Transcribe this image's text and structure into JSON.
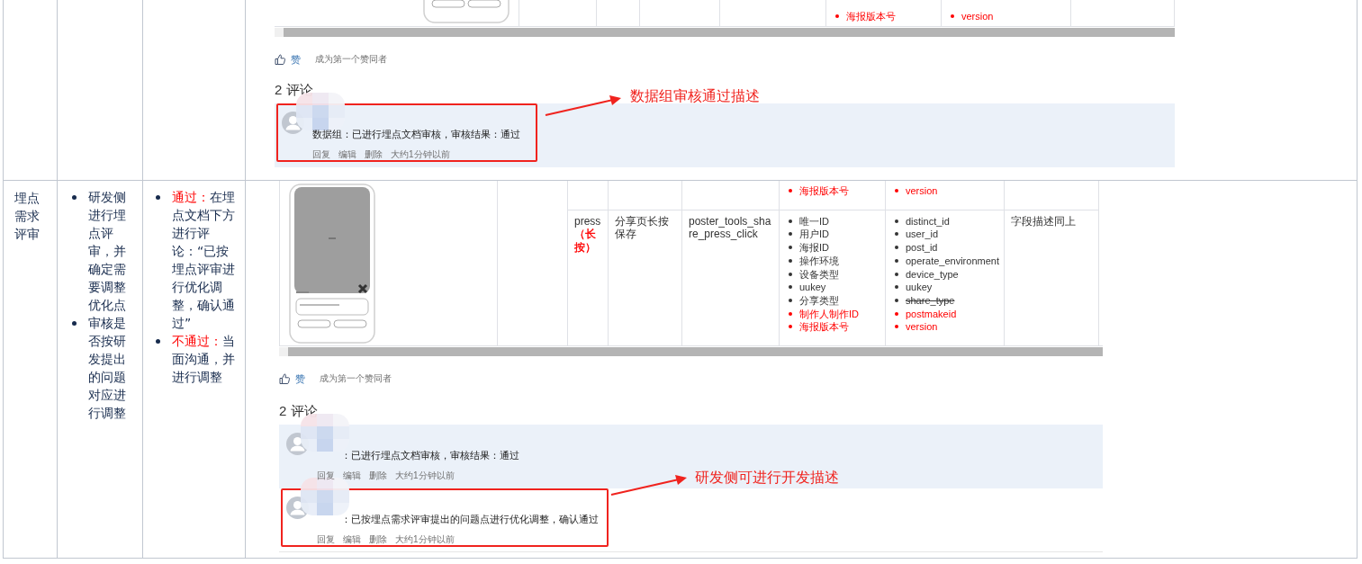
{
  "rows": [
    {
      "screenshot": {
        "side_cells": [
          {
            "kind": "phone"
          },
          {
            "kind": "empty"
          }
        ],
        "table_rows": [
          {
            "cells": [
              {
                "kind": "empty"
              },
              {
                "kind": "empty"
              },
              {
                "kind": "empty"
              },
              {
                "kind": "bullets",
                "items": [
                  {
                    "text": "海报版本号",
                    "color": "#ff0000"
                  }
                ]
              },
              {
                "kind": "bullets",
                "items": [
                  {
                    "text": "version",
                    "color": "#ff0000"
                  }
                ]
              },
              {
                "kind": "empty"
              }
            ]
          }
        ],
        "like": {
          "label": "赞",
          "note": "成为第一个赞同者"
        },
        "comments_heading": "2 评论",
        "comments": [
          {
            "text": "数据组：已进行埋点文档审核，审核结果：通过",
            "actions": [
              "回复",
              "编辑",
              "删除"
            ],
            "time": "大约1分钟以前",
            "highlighted": true,
            "name_hidden": false,
            "annotated": true
          }
        ],
        "annotation": {
          "label": "数据组审核通过描述"
        }
      }
    },
    {
      "stage": "埋点需求评审",
      "dev_steps": [
        "研发侧进行埋点评审，并确定需要调整优化点",
        "审核是否按研发提出的问题对应进行调整"
      ],
      "review_results": [
        {
          "segments": [
            {
              "text": "通过：",
              "color": "#ff0000"
            },
            {
              "text": "在埋点文档下方进行评论：“已按埋点评审进行优化调整，确认通过”"
            }
          ]
        },
        {
          "segments": [
            {
              "text": "不通过：",
              "color": "#ff0000"
            },
            {
              "text": "当面沟通，并进行调整"
            }
          ]
        }
      ],
      "screenshot": {
        "side_cells": [
          {
            "kind": "phone"
          },
          {
            "kind": "empty"
          }
        ],
        "table_rows": [
          {
            "cells": [
              {
                "kind": "empty"
              },
              {
                "kind": "empty"
              },
              {
                "kind": "empty"
              },
              {
                "kind": "bullets",
                "items": [
                  {
                    "text": "海报版本号",
                    "color": "#ff0000"
                  }
                ]
              },
              {
                "kind": "bullets",
                "items": [
                  {
                    "text": "version",
                    "color": "#ff0000"
                  }
                ]
              },
              {
                "kind": "empty"
              }
            ]
          },
          {
            "cells": [
              {
                "kind": "text",
                "segments": [
                  {
                    "text": "press"
                  },
                  {
                    "text": "（长按）",
                    "color": "#ff0000"
                  }
                ]
              },
              {
                "kind": "text",
                "segments": [
                  {
                    "text": "分享页长按保存"
                  }
                ]
              },
              {
                "kind": "text",
                "segments": [
                  {
                    "text": "poster_tools_share_press_click"
                  }
                ]
              },
              {
                "kind": "bullets",
                "items": [
                  {
                    "text": "唯一ID"
                  },
                  {
                    "text": "用户ID"
                  },
                  {
                    "text": "海报ID"
                  },
                  {
                    "text": "操作环境"
                  },
                  {
                    "text": "设备类型"
                  },
                  {
                    "text": "uukey"
                  },
                  {
                    "text": "分享类型"
                  },
                  {
                    "text": "制作人制作ID",
                    "color": "#ff0000"
                  },
                  {
                    "text": "海报版本号",
                    "color": "#ff0000"
                  }
                ]
              },
              {
                "kind": "bullets",
                "items": [
                  {
                    "text": "distinct_id",
                    "struck": false
                  },
                  {
                    "text": "user_id",
                    "struck": false
                  },
                  {
                    "text": "post_id",
                    "struck": false
                  },
                  {
                    "text": "operate_environment",
                    "struck": false
                  },
                  {
                    "text": "device_type",
                    "struck": false
                  },
                  {
                    "text": "uukey",
                    "struck": false
                  },
                  {
                    "text": "share_type",
                    "struck": true
                  },
                  {
                    "text": "postmakeid",
                    "color": "#ff0000",
                    "struck": false
                  },
                  {
                    "text": "version",
                    "color": "#ff0000",
                    "struck": false
                  }
                ]
              },
              {
                "kind": "text",
                "segments": [
                  {
                    "text": "字段描述同上"
                  }
                ]
              }
            ]
          }
        ],
        "like": {
          "label": "赞",
          "note": "成为第一个赞同者"
        },
        "comments_heading": "2 评论",
        "comments": [
          {
            "text": "：已进行埋点文档审核，审核结果：通过",
            "actions": [
              "回复",
              "编辑",
              "删除"
            ],
            "time": "大约1分钟以前",
            "highlighted": true,
            "name_hidden": true,
            "annotated": false
          },
          {
            "text": "：已按埋点需求评审提出的问题点进行优化调整，确认通过",
            "actions": [
              "回复",
              "编辑",
              "删除"
            ],
            "time": "大约1分钟以前",
            "highlighted": false,
            "name_hidden": true,
            "annotated": true
          }
        ],
        "annotation": {
          "label": "研发侧可进行开发描述"
        }
      }
    }
  ]
}
